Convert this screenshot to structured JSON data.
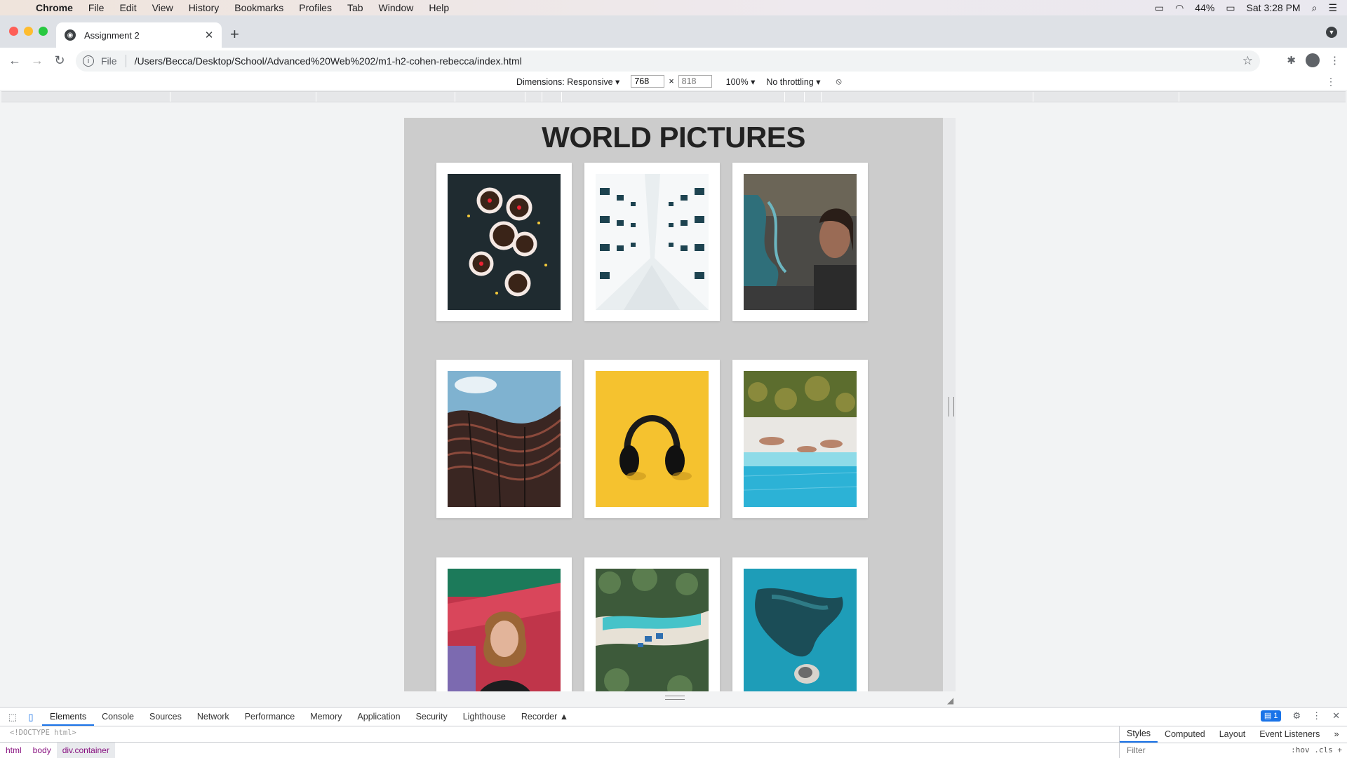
{
  "menubar": {
    "app": "Chrome",
    "items": [
      "File",
      "Edit",
      "View",
      "History",
      "Bookmarks",
      "Profiles",
      "Tab",
      "Window",
      "Help"
    ],
    "battery": "44%",
    "clock": "Sat 3:28 PM"
  },
  "tab": {
    "title": "Assignment 2"
  },
  "omnibox": {
    "scheme": "File",
    "path": "/Users/Becca/Desktop/School/Advanced%20Web%202/m1-h2-cohen-rebecca/index.html"
  },
  "device_toolbar": {
    "dimensions_label": "Dimensions: Responsive ▾",
    "width": "768",
    "times": "×",
    "height": "818",
    "zoom": "100% ▾",
    "throttling": "No throttling ▾"
  },
  "page": {
    "heading": "WORLD PICTURES",
    "photos": [
      {
        "icon": "cupcakes-photo"
      },
      {
        "icon": "building-facade-photo"
      },
      {
        "icon": "graffiti-portrait-photo"
      },
      {
        "icon": "curved-building-photo"
      },
      {
        "icon": "headphones-photo"
      },
      {
        "icon": "beach-aerial-photo"
      },
      {
        "icon": "mural-portrait-photo"
      },
      {
        "icon": "tropical-coast-photo"
      },
      {
        "icon": "reef-aerial-photo"
      }
    ]
  },
  "devtools": {
    "tabs": [
      "Elements",
      "Console",
      "Sources",
      "Network",
      "Performance",
      "Memory",
      "Application",
      "Security",
      "Lighthouse",
      "Recorder ▲"
    ],
    "active_tab": "Elements",
    "issues_badge": "1",
    "doctype": "<!DOCTYPE html>",
    "breadcrumbs": [
      "html",
      "body",
      "div.container"
    ],
    "styles_tabs": [
      "Styles",
      "Computed",
      "Layout",
      "Event Listeners"
    ],
    "filter_placeholder": "Filter",
    "filter_tools": ":hov .cls +"
  },
  "colors": {
    "page_background": "#cccccc",
    "card_background": "#ffffff",
    "accent": "#1a73e8"
  }
}
